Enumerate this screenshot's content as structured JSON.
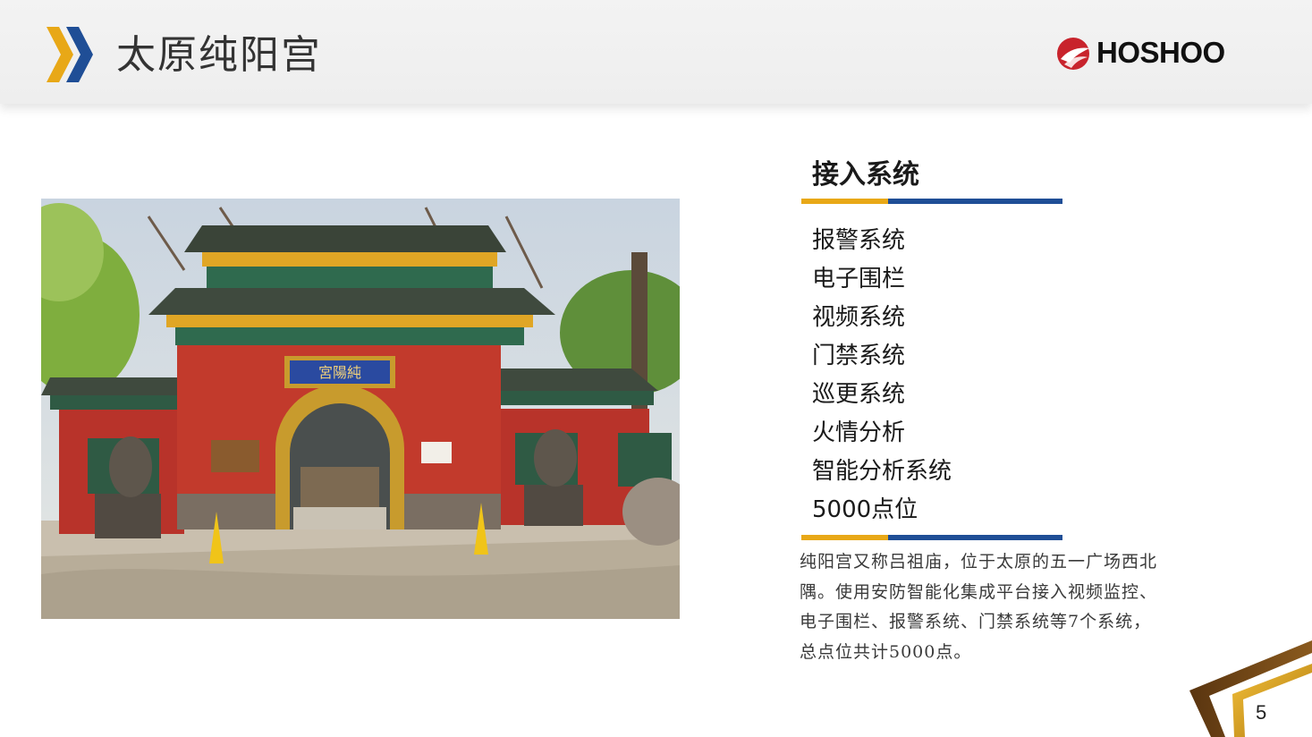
{
  "header": {
    "title": "太原纯阳宫",
    "logo_text": "HOSHOO",
    "chevron_icon": "double-chevron-right",
    "colors": {
      "chevron_gold": "#e8a817",
      "chevron_blue": "#1f4e96",
      "logo_red": "#c8232c"
    }
  },
  "photo": {
    "plaque_text": "宮陽純"
  },
  "section": {
    "title": "接入系统",
    "items": [
      "报警系统",
      "电子围栏",
      "视频系统",
      "门禁系统",
      "巡更系统",
      "火情分析",
      "智能分析系统",
      "5000点位"
    ],
    "description": [
      "纯阳宫又称吕祖庙，位于太原的五一广场西北",
      "隅。使用安防智能化集成平台接入视频监控、",
      "电子围栏、报警系统、门禁系统等7个系统，",
      "总点位共计5000点。"
    ],
    "colors": {
      "gold": "#e8a817",
      "blue": "#1f4e96"
    }
  },
  "footer": {
    "page_number": "5"
  }
}
